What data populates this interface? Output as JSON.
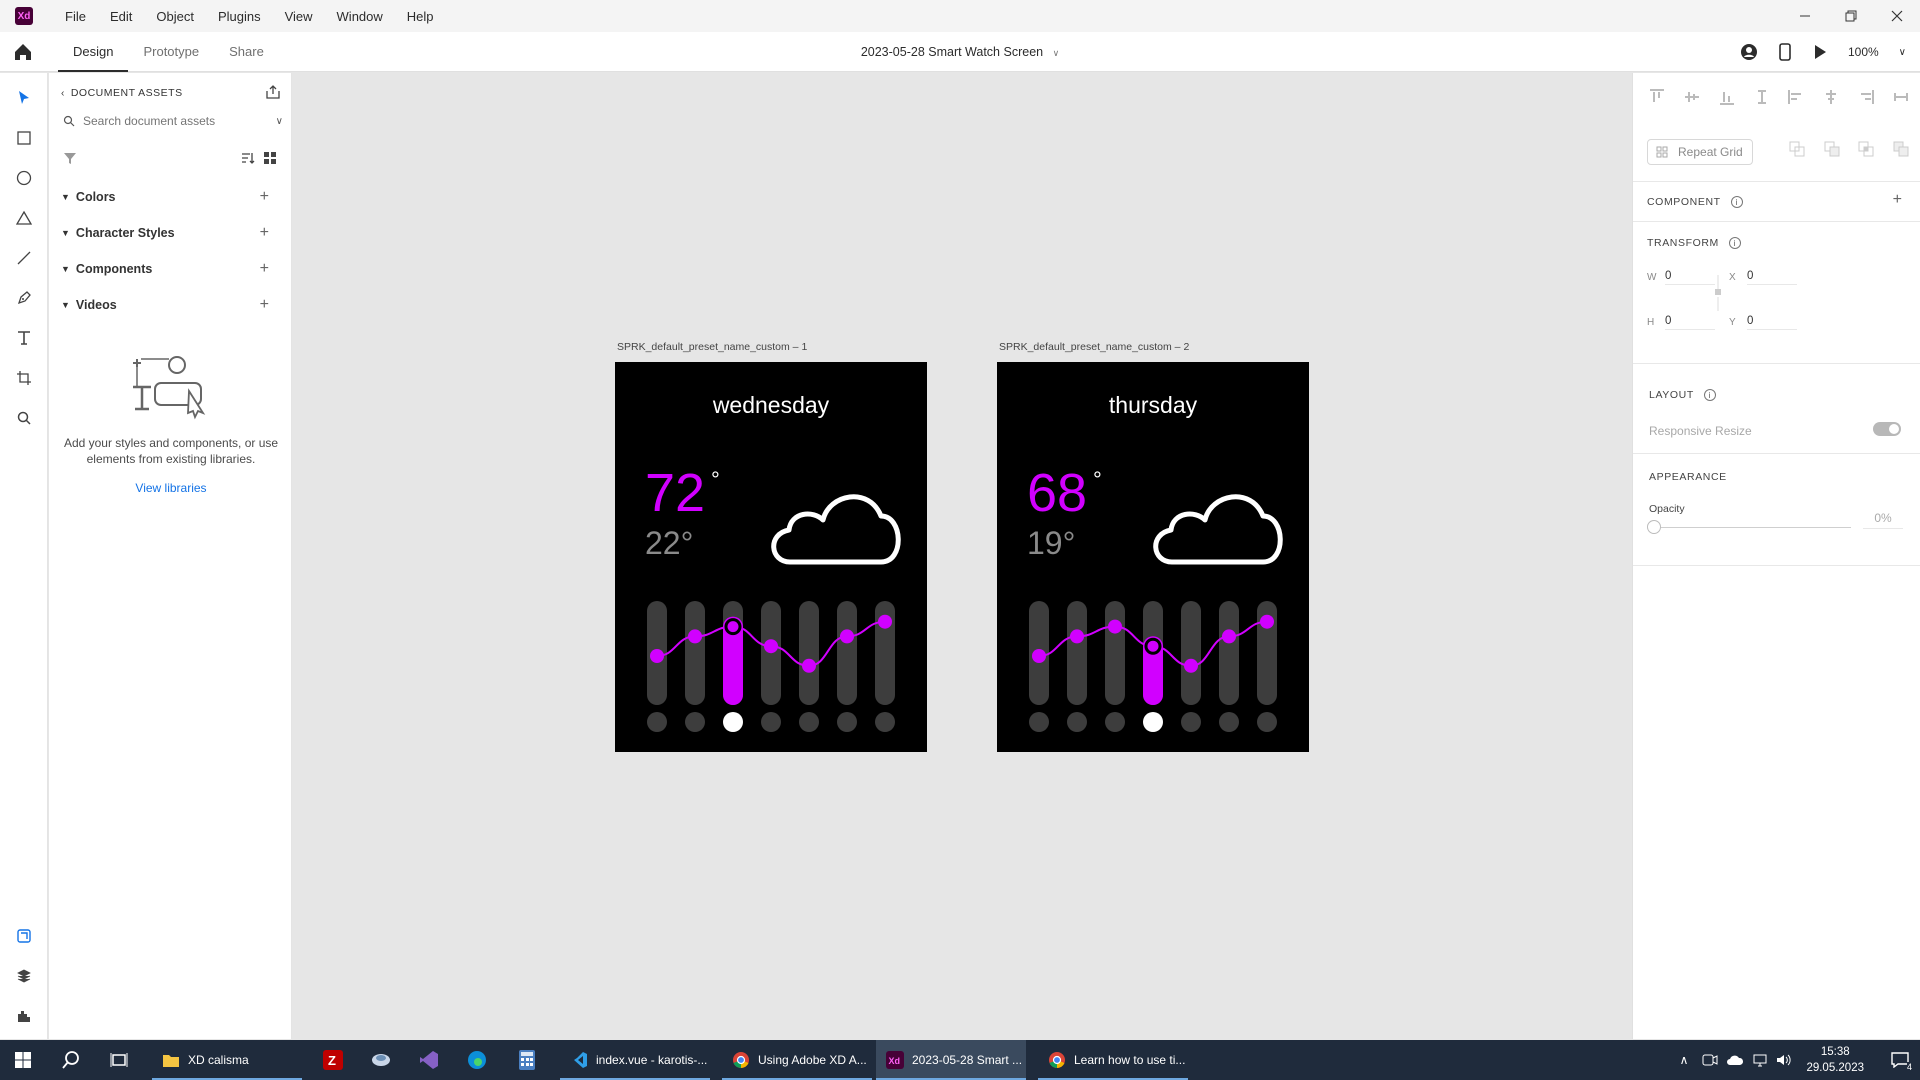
{
  "app": {
    "logo_text": "Xd",
    "menu": [
      "File",
      "Edit",
      "Object",
      "Plugins",
      "View",
      "Window",
      "Help"
    ],
    "window_controls": [
      "minimize",
      "restore",
      "close"
    ]
  },
  "toolbar": {
    "tabs": [
      "Design",
      "Prototype",
      "Share"
    ],
    "active_tab": "Design",
    "doc_title": "2023-05-28 Smart Watch Screen",
    "zoom": "100%"
  },
  "assets": {
    "heading": "DOCUMENT ASSETS",
    "search_placeholder": "Search document assets",
    "sections": [
      "Colors",
      "Character Styles",
      "Components",
      "Videos"
    ],
    "empty_text": "Add your styles and components, or use elements from existing libraries.",
    "view_libraries": "View libraries"
  },
  "artboards": [
    {
      "label": "SPRK_default_preset_name_custom – 1",
      "day": "wednesday",
      "high": "72",
      "high_deg": "°",
      "low": "22°",
      "active_index": 2
    },
    {
      "label": "SPRK_default_preset_name_custom – 2",
      "day": "thursday",
      "high": "68",
      "high_deg": "°",
      "low": "19°",
      "active_index": 3
    }
  ],
  "chart_data": {
    "type": "line",
    "x": [
      1,
      2,
      3,
      4,
      5,
      6,
      7
    ],
    "series": [
      {
        "values": [
          5,
          7,
          8,
          6,
          4,
          7,
          8.5
        ]
      }
    ],
    "colors": {
      "accent": "#d100ff",
      "bar": "#3d3d3d",
      "dot": "#3d3d3d",
      "active_dot": "#ffffff"
    }
  },
  "inspector": {
    "repeat_grid": "Repeat Grid",
    "component": "COMPONENT",
    "transform": "TRANSFORM",
    "w": {
      "key": "W",
      "value": "0"
    },
    "h": {
      "key": "H",
      "value": "0"
    },
    "x": {
      "key": "X",
      "value": "0"
    },
    "y": {
      "key": "Y",
      "value": "0"
    },
    "layout": "LAYOUT",
    "responsive_resize": "Responsive Resize",
    "appearance": "APPEARANCE",
    "opacity_label": "Opacity",
    "opacity_value": "0%"
  },
  "taskbar": {
    "apps": [
      {
        "label": "XD calisma",
        "icon": "folder-icon"
      },
      {
        "label": "index.vue - karotis-...",
        "icon": "vscode-icon"
      },
      {
        "label": "Using Adobe XD A...",
        "icon": "chrome-icon"
      },
      {
        "label": "2023-05-28 Smart ...",
        "icon": "xd-icon"
      },
      {
        "label": "Learn how to use ti...",
        "icon": "chrome-icon"
      }
    ],
    "time": "15:38",
    "date": "29.05.2023",
    "notification_count": "4"
  }
}
